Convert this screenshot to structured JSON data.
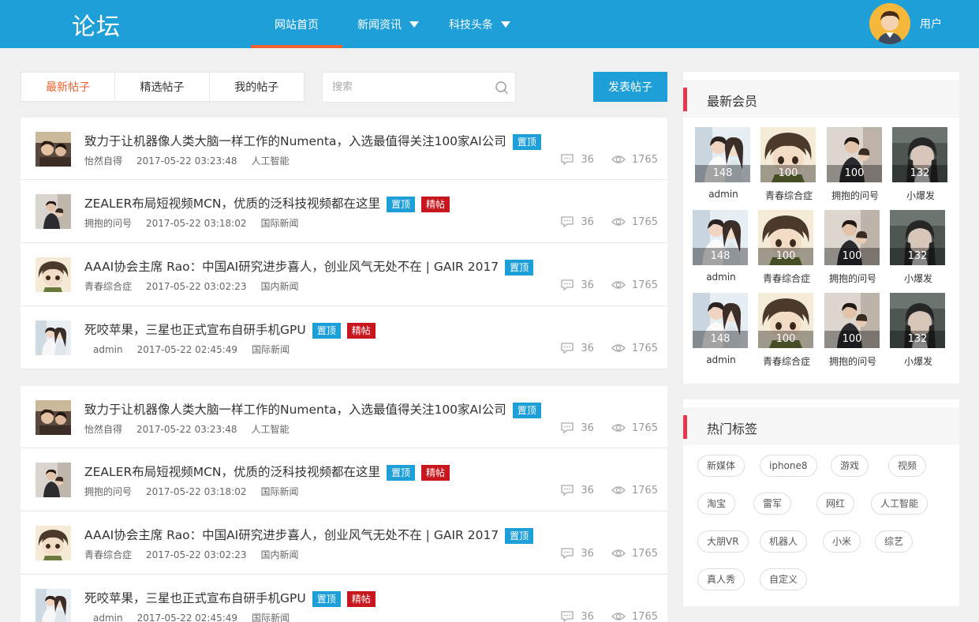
{
  "header": {
    "logo": "论坛",
    "nav": [
      {
        "label": "网站首页",
        "active": true
      },
      {
        "label": "新闻资讯",
        "dropdown": true
      },
      {
        "label": "科技头条",
        "dropdown": true
      }
    ],
    "user_label": "用户",
    "accent": "#1e9fd8",
    "active_underline": "#f0622e"
  },
  "toolbar": {
    "tabs": [
      "最新帖子",
      "精选帖子",
      "我的帖子"
    ],
    "search_placeholder": "搜索",
    "post_button": "发表帖子"
  },
  "posts": [
    {
      "title": "致力于让机器像人类大脑一样工作的Numenta，入选最值得关注100家AI公司",
      "badges": [
        "置顶"
      ],
      "author": "怡然自得",
      "time": "2017-05-22 03:23:48",
      "category": "人工智能",
      "comments": "36",
      "views": "1765"
    },
    {
      "title": "ZEALER布局短视频MCN，优质的泛科技视频都在这里",
      "badges": [
        "置顶",
        "精帖"
      ],
      "author": "拥抱的问号",
      "time": "2017-05-22 03:18:02",
      "category": "国际新闻",
      "comments": "36",
      "views": "1765"
    },
    {
      "title": "AAAI协会主席 Rao：中国AI研究进步喜人，创业风气无处不在 | GAIR 2017",
      "badges": [
        "置顶"
      ],
      "author": "青春综合症",
      "time": "2017-05-22 03:02:23",
      "category": "国内新闻",
      "comments": "36",
      "views": "1765"
    },
    {
      "title": "死咬苹果，三星也正式宣布自研手机GPU",
      "badges": [
        "置顶",
        "精帖"
      ],
      "author": "admin",
      "time": "2017-05-22 02:45:49",
      "category": "国际新闻",
      "comments": "36",
      "views": "1765"
    },
    {
      "title": "致力于让机器像人类大脑一样工作的Numenta，入选最值得关注100家AI公司",
      "badges": [
        "置顶"
      ],
      "author": "怡然自得",
      "time": "2017-05-22 03:23:48",
      "category": "人工智能",
      "comments": "36",
      "views": "1765"
    },
    {
      "title": "ZEALER布局短视频MCN，优质的泛科技视频都在这里",
      "badges": [
        "置顶",
        "精帖"
      ],
      "author": "拥抱的问号",
      "time": "2017-05-22 03:18:02",
      "category": "国际新闻",
      "comments": "36",
      "views": "1765"
    },
    {
      "title": "AAAI协会主席 Rao：中国AI研究进步喜人，创业风气无处不在 | GAIR 2017",
      "badges": [
        "置顶"
      ],
      "author": "青春综合症",
      "time": "2017-05-22 03:02:23",
      "category": "国内新闻",
      "comments": "36",
      "views": "1765"
    },
    {
      "title": "死咬苹果，三星也正式宣布自研手机GPU",
      "badges": [
        "置顶",
        "精帖"
      ],
      "author": "admin",
      "time": "2017-05-22 02:45:49",
      "category": "国际新闻",
      "comments": "36",
      "views": "1765"
    }
  ],
  "members_panel": {
    "title": "最新会员",
    "members": [
      {
        "name": "admin",
        "count": "148"
      },
      {
        "name": "青春综合症",
        "count": "100"
      },
      {
        "name": "拥抱的问号",
        "count": "100"
      },
      {
        "name": "小爆发",
        "count": "132"
      },
      {
        "name": "admin",
        "count": "148"
      },
      {
        "name": "青春综合症",
        "count": "100"
      },
      {
        "name": "拥抱的问号",
        "count": "100"
      },
      {
        "name": "小爆发",
        "count": "132"
      },
      {
        "name": "admin",
        "count": "148"
      },
      {
        "name": "青春综合症",
        "count": "100"
      },
      {
        "name": "拥抱的问号",
        "count": "100"
      },
      {
        "name": "小爆发",
        "count": "132"
      }
    ]
  },
  "tags_panel": {
    "title": "热门标签",
    "tags": [
      "新媒体",
      "iphone8",
      "游戏",
      "视频",
      "淘宝",
      "雷军",
      "网红",
      "人工智能",
      "大朋VR",
      "机器人",
      "小米",
      "综艺",
      "真人秀",
      "自定义"
    ]
  }
}
